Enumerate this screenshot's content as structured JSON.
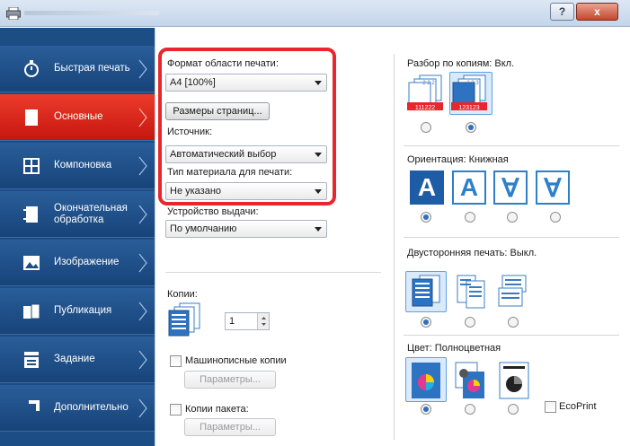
{
  "window": {
    "help_label": "?",
    "close_label": "x"
  },
  "sidebar": {
    "items": [
      {
        "label": "Быстрая печать",
        "icon": "stopwatch-icon"
      },
      {
        "label": "Основные",
        "icon": "page-icon"
      },
      {
        "label": "Компоновка",
        "icon": "layout-icon"
      },
      {
        "label": "Окончательная обработка",
        "icon": "finishing-icon"
      },
      {
        "label": "Изображение",
        "icon": "image-icon"
      },
      {
        "label": "Публикация",
        "icon": "publish-icon"
      },
      {
        "label": "Задание",
        "icon": "job-icon"
      },
      {
        "label": "Дополнительно",
        "icon": "advanced-icon"
      }
    ],
    "active_index": 1
  },
  "basic": {
    "print_size_label": "Формат области печати:",
    "print_size_value": "A4  [100%]",
    "page_sizes_button": "Размеры страниц...",
    "source_label": "Источник:",
    "source_value": "Автоматический выбор",
    "media_type_label": "Тип материала для печати:",
    "media_type_value": "Не указано",
    "output_label": "Устройство выдачи:",
    "output_value": "По умолчанию",
    "copies_label": "Копии:",
    "copies_value": "1",
    "mopy_label": "Машинописные копии",
    "mopy_settings": "Параметры...",
    "job_copies_label": "Копии пакета:",
    "job_copies_settings": "Параметры..."
  },
  "right": {
    "collate_label": "Разбор по копиям:",
    "collate_value": "Вкл.",
    "orientation_label": "Ориентация:",
    "orientation_value": "Книжная",
    "orientation_letters": [
      "A",
      "A",
      "∀",
      "∀"
    ],
    "duplex_label": "Двусторонняя печать:",
    "duplex_value": "Выкл.",
    "color_label": "Цвет:",
    "color_value": "Полноцветная",
    "ecoprint_label": "EcoPrint",
    "collate_strip_1": "111222",
    "collate_strip_2": "123123",
    "collate_digits_1": "2 2 2",
    "collate_digits_2": "1 2 3"
  },
  "colors": {
    "accent_red": "#e8262d",
    "sidebar_blue": "#1d4d85",
    "selected_blue": "#1f5ca6"
  }
}
